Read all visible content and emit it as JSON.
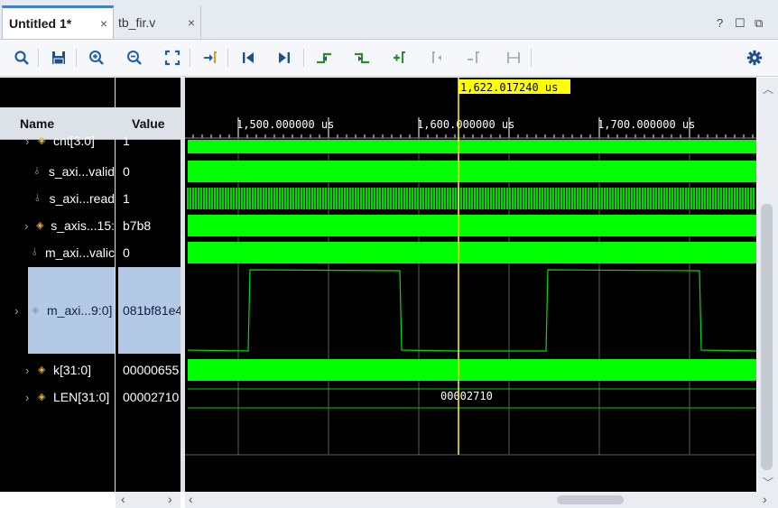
{
  "tabs": [
    {
      "label": "Untitled 1*",
      "close": "×"
    },
    {
      "label": "tb_fir.v",
      "close": "×"
    }
  ],
  "window_controls": {
    "help": "?",
    "restore": "☐",
    "maximize": "⧉"
  },
  "toolbar": {
    "icons": [
      "search-icon",
      "save-icon",
      "zoom-in-icon",
      "zoom-out-icon",
      "zoom-fit-icon",
      "go-to-cursor-icon",
      "go-to-start-icon",
      "go-to-end-icon",
      "previous-transition-icon",
      "next-transition-icon",
      "add-marker-icon",
      "previous-marker-icon",
      "next-marker-icon",
      "swap-cursors-icon",
      "settings-gear-icon"
    ]
  },
  "columns": {
    "name": "Name",
    "value": "Value"
  },
  "cursor_label": "1,622.017240 us",
  "time_ticks": [
    "1,500.000000 us",
    "1,600.000000 us",
    "1,700.000000 us"
  ],
  "signals": [
    {
      "name": "cnt[3:0]",
      "value": "1",
      "kind": "bus",
      "expandable": true,
      "selected": false
    },
    {
      "name": "s_axi...valid",
      "value": "0",
      "kind": "bit",
      "expandable": false,
      "selected": false
    },
    {
      "name": "s_axi...read",
      "value": "1",
      "kind": "bit",
      "expandable": false,
      "selected": false
    },
    {
      "name": "s_axis...15:",
      "value": "b7b8",
      "kind": "bus",
      "expandable": true,
      "selected": false
    },
    {
      "name": "m_axi...valic",
      "value": "0",
      "kind": "bit",
      "expandable": false,
      "selected": false
    },
    {
      "name": "m_axi...9:0]",
      "value": "081bf81e4",
      "kind": "analog",
      "expandable": true,
      "selected": true
    },
    {
      "name": "k[31:0]",
      "value": "00000655",
      "kind": "bus",
      "expandable": true,
      "selected": false
    },
    {
      "name": "LEN[31:0]",
      "value": "00002710",
      "kind": "bus",
      "expandable": true,
      "selected": false
    }
  ],
  "len_wave_value": "00002710",
  "colors": {
    "wave": "#00ff00",
    "cursor": "#ffff00",
    "selected_row": "#b4c9e6",
    "background": "#000000"
  }
}
